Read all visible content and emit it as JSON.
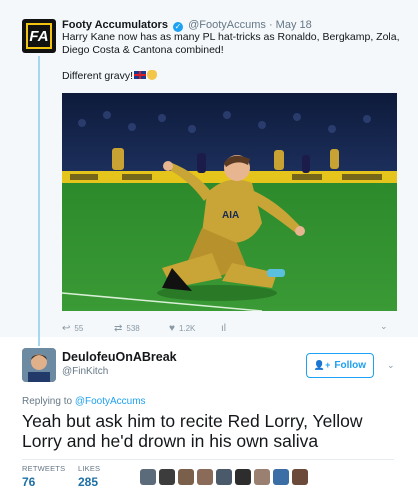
{
  "tweet1": {
    "author_name": "Footy Accumulators",
    "handle": "@FootyAccums",
    "date": "May 18",
    "separator": "·",
    "avatar_text": "FA",
    "verified_glyph": "✓",
    "text": "Harry Kane now has as many PL hat-tricks as Ronaldo, Bergkamp, Zola, Diego Costa & Cantona combined!",
    "text_line2": "Different gravy!",
    "emojis": [
      "flag-icon",
      "clap-icon"
    ],
    "actions": {
      "replies": "55",
      "retweets": "538",
      "likes": "1.2K",
      "reply_icon": "reply-icon",
      "retweet_icon": "retweet-icon",
      "like_icon": "heart-icon",
      "analytics_icon": "analytics-icon"
    }
  },
  "tweet2": {
    "author_name": "DeulofeuOnABreak",
    "handle": "@FinKitch",
    "follow_label": "Follow",
    "follow_icon": "person-add-icon",
    "reply_label": "Replying to",
    "reply_handle": "@FootyAccums",
    "text": "Yeah but ask him to recite Red Lorry, Yellow Lorry and he'd drown in his own saliva",
    "retweets_label": "RETWEETS",
    "retweets_value": "76",
    "likes_label": "LIKES",
    "likes_value": "285",
    "liker_count": 9
  },
  "colors": {
    "accent": "#1da1f2",
    "thread_line": "#a5d8f0",
    "muted": "#657786",
    "gold": "#f2c40f"
  }
}
